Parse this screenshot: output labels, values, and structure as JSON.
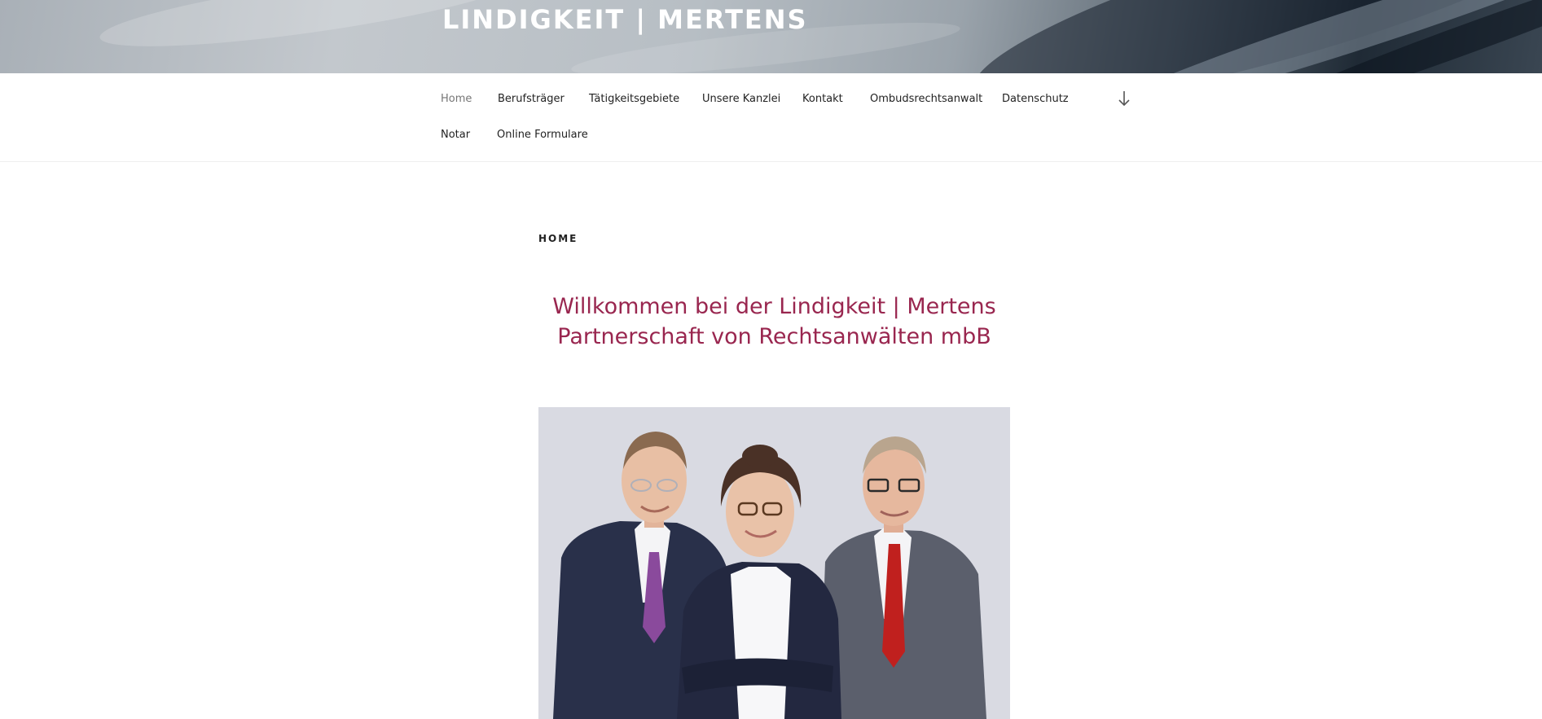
{
  "header": {
    "site_title": "LINDIGKEIT | MERTENS"
  },
  "nav": {
    "items": [
      {
        "label": "Home",
        "current": true
      },
      {
        "label": "Berufsträger"
      },
      {
        "label": "Tätigkeitsgebiete"
      },
      {
        "label": "Unsere Kanzlei"
      },
      {
        "label": "Kontakt"
      },
      {
        "label": "Ombudsrechtsanwalt"
      },
      {
        "label": "Datenschutz"
      },
      {
        "label": "Notar"
      },
      {
        "label": "Online Formulare"
      }
    ],
    "scroll_icon": "arrow-down-icon"
  },
  "main": {
    "page_label": "HOME",
    "welcome_line1": "Willkommen bei der Lindigkeit | Mertens",
    "welcome_line2": "Partnerschaft von Rechtsanwälten mbB"
  },
  "colors": {
    "accent": "#99264f",
    "nav_text": "#222222",
    "nav_current": "#767676",
    "photo_background": "#d9dae2"
  }
}
